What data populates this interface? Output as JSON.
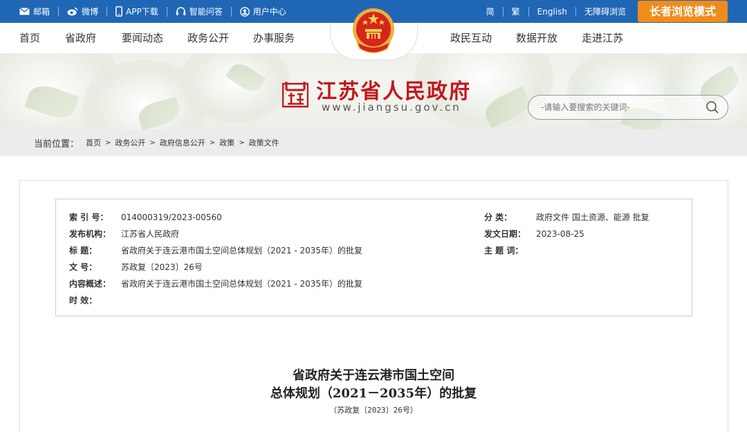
{
  "topbar": {
    "mail": "邮箱",
    "weibo": "微博",
    "app": "APP下载",
    "qa": "智能问答",
    "user": "用户中心",
    "simplified": "简",
    "traditional": "繁",
    "english": "English",
    "accessible": "无障碍浏览",
    "elder_mode": "长者浏览模式"
  },
  "nav": {
    "home": "首页",
    "gov": "省政府",
    "news": "要闻动态",
    "open": "政务公开",
    "service": "办事服务",
    "interact": "政民互动",
    "data": "数据开放",
    "about": "走进江苏"
  },
  "header": {
    "title": "江苏省人民政府",
    "url": "www.jiangsu.gov.cn",
    "search_placeholder": "-请输入要搜索的关键词-"
  },
  "breadcrumb": {
    "label": "当前位置：",
    "items": [
      "首页",
      "政务公开",
      "政府信息公开",
      "政策",
      "政策文件"
    ]
  },
  "meta": {
    "index_key": "索  引  号：",
    "index_val": "014000319/2023-00560",
    "org_key": "发布机构：",
    "org_val": "江苏省人民政府",
    "title_key": "标        题：",
    "title_val": "省政府关于连云港市国土空间总体规划（2021 - 2035年）的批复",
    "docno_key": "文        号：",
    "docno_val": "苏政复〔2023〕26号",
    "summary_key": "内容概述：",
    "summary_val": "省政府关于连云港市国土空间总体规划（2021 - 2035年）的批复",
    "validity_key": "时        效：",
    "validity_val": "",
    "category_key": "分        类：",
    "category_val": "政府文件 国土资源、能源 批复",
    "date_key": "发文日期：",
    "date_val": "2023-08-25",
    "topic_key": "主  题  词：",
    "topic_val": ""
  },
  "document": {
    "title_line1": "省政府关于连云港市国土空间",
    "title_line2": "总体规划（2021－2035年）的批复",
    "number": "（苏政复〔2023〕26号）"
  },
  "colors": {
    "topbar": "#1f67b5",
    "elder_button": "#f08c1c",
    "title_red": "#c4161c"
  }
}
